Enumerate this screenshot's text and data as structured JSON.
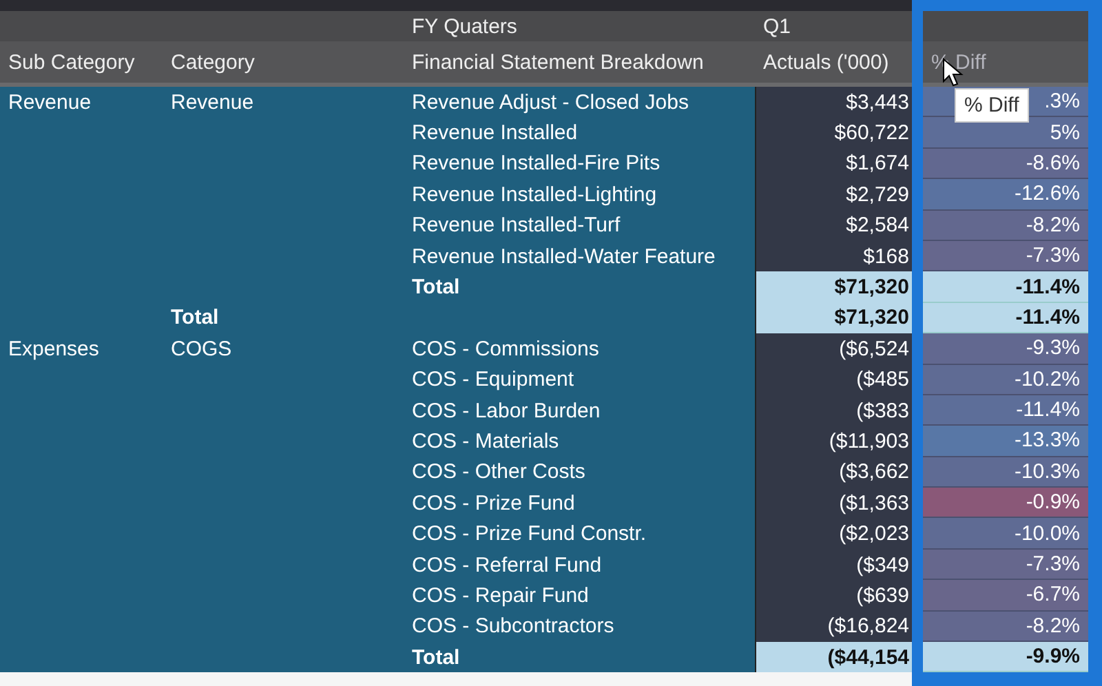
{
  "header": {
    "column_group": "FY Quaters",
    "period": "Q1",
    "columns": [
      "Sub Category",
      "Category",
      "Financial Statement Breakdown",
      "Actuals ('000)",
      "% Diff"
    ]
  },
  "rows": [
    {
      "kind": "detail",
      "sub_category": "Revenue",
      "category": "Revenue",
      "breakdown": "Revenue Adjust - Closed Jobs",
      "actuals": "$3,443",
      "diff": ".3%",
      "color": "#5b6f9c"
    },
    {
      "kind": "detail",
      "breakdown": "Revenue Installed",
      "actuals": "$60,722",
      "diff": "5%",
      "color": "#5d6d98"
    },
    {
      "kind": "detail",
      "breakdown": "Revenue Installed-Fire Pits",
      "actuals": "$1,674",
      "diff": "-8.6%",
      "color": "#626890"
    },
    {
      "kind": "detail",
      "breakdown": "Revenue Installed-Lighting",
      "actuals": "$2,729",
      "diff": "-12.6%",
      "color": "#5a72a0"
    },
    {
      "kind": "detail",
      "breakdown": "Revenue Installed-Turf",
      "actuals": "$2,584",
      "diff": "-8.2%",
      "color": "#63688f"
    },
    {
      "kind": "detail",
      "breakdown": "Revenue Installed-Water Feature",
      "actuals": "$168",
      "diff": "-7.3%",
      "color": "#66678d"
    },
    {
      "kind": "total",
      "breakdown": "Total",
      "actuals": "$71,320",
      "diff": "-11.4%",
      "color": "#b9d9ea"
    },
    {
      "kind": "category_total",
      "category": "Total",
      "actuals": "$71,320",
      "diff": "-11.4%",
      "color": "#b9d9ea"
    },
    {
      "kind": "detail",
      "sub_category": "Expenses",
      "category": "COGS",
      "breakdown": "COS - Commissions",
      "actuals": "($6,524",
      "diff": "-9.3%",
      "color": "#626890"
    },
    {
      "kind": "detail",
      "breakdown": "COS - Equipment",
      "actuals": "($485",
      "diff": "-10.2%",
      "color": "#5f6b94"
    },
    {
      "kind": "detail",
      "breakdown": "COS - Labor Burden",
      "actuals": "($383",
      "diff": "-11.4%",
      "color": "#5d6e99"
    },
    {
      "kind": "detail",
      "breakdown": "COS - Materials",
      "actuals": "($11,903",
      "diff": "-13.3%",
      "color": "#5877a6"
    },
    {
      "kind": "detail",
      "breakdown": "COS - Other Costs",
      "actuals": "($3,662",
      "diff": "-10.3%",
      "color": "#5f6b94"
    },
    {
      "kind": "detail",
      "breakdown": "COS - Prize Fund",
      "actuals": "($1,363",
      "diff": "-0.9%",
      "color": "#8a5878"
    },
    {
      "kind": "detail",
      "breakdown": "COS - Prize Fund Constr.",
      "actuals": "($2,023",
      "diff": "-10.0%",
      "color": "#5f6b94"
    },
    {
      "kind": "detail",
      "breakdown": "COS - Referral Fund",
      "actuals": "($349",
      "diff": "-7.3%",
      "color": "#66678d"
    },
    {
      "kind": "detail",
      "breakdown": "COS - Repair Fund",
      "actuals": "($639",
      "diff": "-6.7%",
      "color": "#69668b"
    },
    {
      "kind": "detail",
      "breakdown": "COS - Subcontractors",
      "actuals": "($16,824",
      "diff": "-8.2%",
      "color": "#63688f"
    },
    {
      "kind": "total",
      "breakdown": "Total",
      "actuals": "($44,154",
      "diff": "-9.9%",
      "color": "#b9d9ea"
    }
  ],
  "tooltip": "% Diff"
}
